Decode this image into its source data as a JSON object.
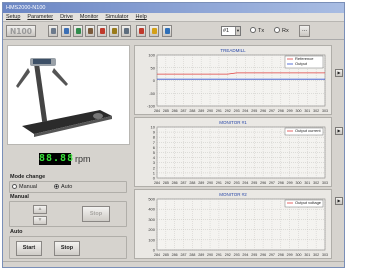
{
  "window": {
    "title": "HMS2000-N100"
  },
  "menu": [
    "Setup",
    "Parameter",
    "Drive",
    "Monitor",
    "Simulator",
    "Help"
  ],
  "toolbar": {
    "model_label": "N100",
    "icons": [
      {
        "name": "wrench-icon",
        "color": "#6c7a8c"
      },
      {
        "name": "sensor-icon",
        "color": "#3b6fb5"
      },
      {
        "name": "globe-icon",
        "color": "#2f8c4c"
      },
      {
        "name": "motor-icon",
        "color": "#7b5a3a"
      },
      {
        "name": "chip-icon",
        "color": "#c0392b"
      },
      {
        "name": "tools-icon",
        "color": "#9a7b1a"
      },
      {
        "name": "gear-icon",
        "color": "#5d6d7e"
      },
      {
        "name": "bottle-red-icon",
        "color": "#c0392b"
      },
      {
        "name": "bottle-yellow-icon",
        "color": "#d4a017"
      },
      {
        "name": "bottle-blue-icon",
        "color": "#2e6fb8"
      }
    ],
    "channel_value": "#1",
    "radio_tx": "Tx",
    "radio_rx": "Rx",
    "more_label": "..."
  },
  "rpm": {
    "display": "88.88",
    "unit": "rpm"
  },
  "mode": {
    "title": "Mode change",
    "manual": "Manual",
    "auto": "Auto",
    "selected": "auto"
  },
  "manual": {
    "title": "Manual",
    "stop_label": "Stop"
  },
  "auto": {
    "title": "Auto",
    "start_label": "Start",
    "stop_label": "Stop"
  },
  "x_ticks": [
    "284",
    "285",
    "286",
    "287",
    "288",
    "289",
    "290",
    "291",
    "292",
    "293",
    "294",
    "295",
    "296",
    "297",
    "298",
    "299",
    "300",
    "301",
    "302",
    "303"
  ],
  "chart_data": [
    {
      "type": "line",
      "title": "TREADMILL",
      "x": [
        284,
        285,
        286,
        287,
        288,
        289,
        290,
        291,
        292,
        293,
        294,
        295,
        296,
        297,
        298,
        299,
        300,
        301,
        302,
        303
      ],
      "ylim": [
        -100,
        100
      ],
      "yticks": [
        "100",
        "50",
        "0",
        "-50",
        "-100"
      ],
      "grid": true,
      "legend": "top-right",
      "series": [
        {
          "name": "Reference",
          "color": "#e04040",
          "values": [
            25,
            25,
            25,
            25,
            25,
            25,
            25,
            25,
            25,
            30,
            30,
            30,
            30,
            30,
            30,
            30,
            30,
            30,
            30,
            30
          ]
        },
        {
          "name": "Output",
          "color": "#3050d0",
          "values": [
            5,
            5,
            5,
            5,
            5,
            5,
            5,
            5,
            5,
            5,
            5,
            5,
            5,
            5,
            5,
            5,
            5,
            5,
            5,
            5
          ]
        }
      ]
    },
    {
      "type": "line",
      "title": "MONITOR #1",
      "x": [
        284,
        285,
        286,
        287,
        288,
        289,
        290,
        291,
        292,
        293,
        294,
        295,
        296,
        297,
        298,
        299,
        300,
        301,
        302,
        303
      ],
      "ylim": [
        0,
        10
      ],
      "yticks": [
        "10",
        "9",
        "8",
        "7",
        "6",
        "5",
        "4",
        "3",
        "2",
        "1",
        "0"
      ],
      "grid": true,
      "legend": "top-right",
      "series": [
        {
          "name": "Output current",
          "color": "#e04040",
          "values": []
        }
      ]
    },
    {
      "type": "line",
      "title": "MONITOR #2",
      "x": [
        284,
        285,
        286,
        287,
        288,
        289,
        290,
        291,
        292,
        293,
        294,
        295,
        296,
        297,
        298,
        299,
        300,
        301,
        302,
        303
      ],
      "ylim": [
        0,
        500
      ],
      "yticks": [
        "500",
        "400",
        "300",
        "200",
        "100",
        "0"
      ],
      "grid": true,
      "legend": "top-right",
      "series": [
        {
          "name": "Output voltage",
          "color": "#e04040",
          "values": []
        }
      ]
    }
  ]
}
